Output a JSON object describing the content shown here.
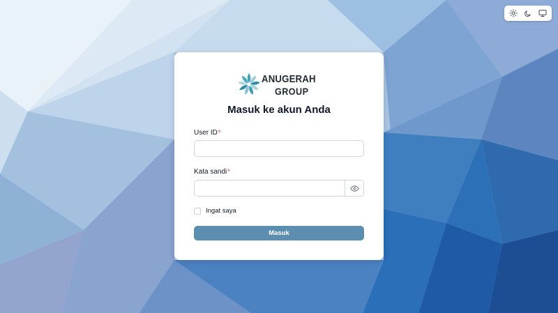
{
  "theme_switcher": {
    "options": [
      {
        "icon": "sun-icon"
      },
      {
        "icon": "moon-icon"
      },
      {
        "icon": "monitor-icon"
      }
    ]
  },
  "logo": {
    "line1": "ANUGERAH",
    "line2": "GROUP",
    "icon": "starburst-logo-icon"
  },
  "login": {
    "title": "Masuk ke akun Anda",
    "userid_label": "User ID",
    "userid_value": "",
    "password_label": "Kata sandi",
    "password_value": "",
    "required_mark": "*",
    "remember_label": "Ingat saya",
    "submit_label": "Masuk"
  },
  "colors": {
    "button": "#5b8eaf",
    "required": "#e11d48"
  }
}
